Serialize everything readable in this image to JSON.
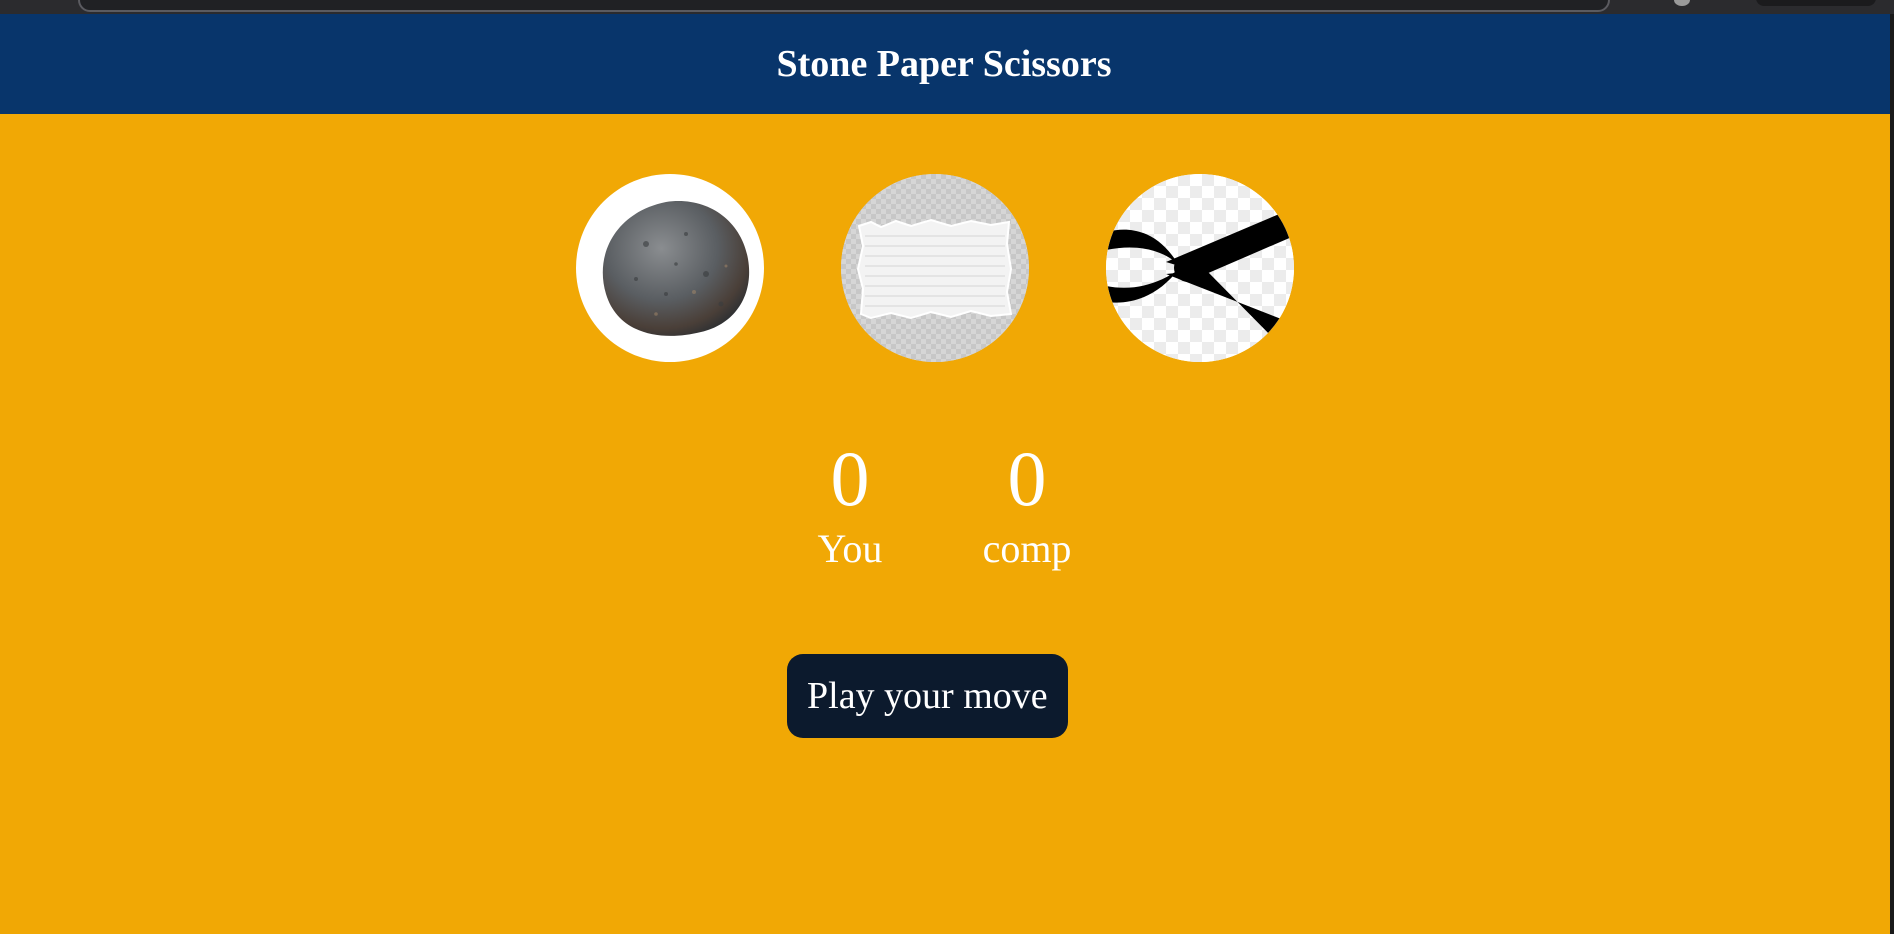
{
  "header": {
    "title": "Stone Paper Scissors"
  },
  "choices": [
    {
      "id": "rock",
      "icon": "rock-icon"
    },
    {
      "id": "paper",
      "icon": "paper-icon"
    },
    {
      "id": "scissors",
      "icon": "scissors-icon"
    }
  ],
  "scoreboard": {
    "user_score": "0",
    "user_label": "You",
    "comp_score": "0",
    "comp_label": "comp"
  },
  "message": {
    "text": "Play your move"
  },
  "colors": {
    "background": "#f1a805",
    "header": "#08356b",
    "message_bg": "#0c1a2d",
    "text": "#ffffff"
  }
}
